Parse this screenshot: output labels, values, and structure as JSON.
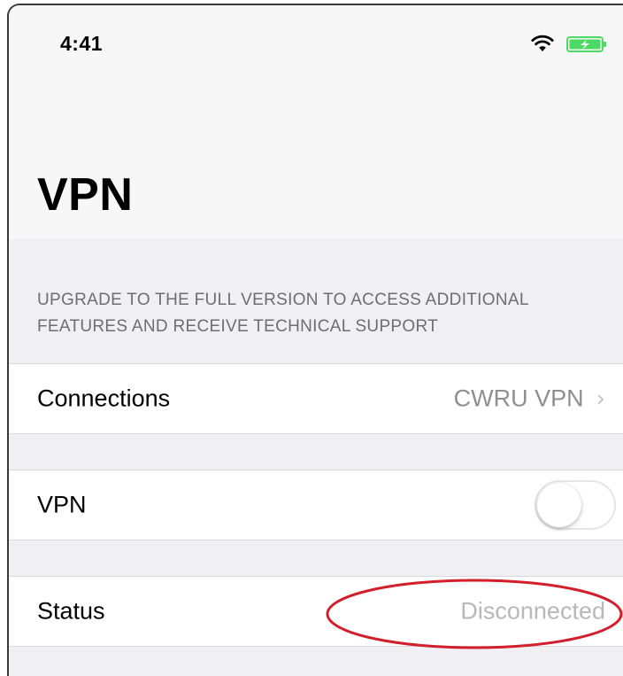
{
  "status_bar": {
    "time": "4:41",
    "wifi_icon": "wifi-icon",
    "battery_icon": "battery-charging-icon",
    "battery_color": "#4cd964"
  },
  "page": {
    "title": "VPN"
  },
  "upgrade_note": "UPGRADE TO THE FULL VERSION TO ACCESS ADDITIONAL FEATURES AND RECEIVE TECHNICAL SUPPORT",
  "connections": {
    "label": "Connections",
    "value": "CWRU VPN",
    "chevron": "›"
  },
  "vpn_toggle": {
    "label": "VPN",
    "state": "off"
  },
  "status": {
    "label": "Status",
    "value": "Disconnected"
  },
  "annotation": {
    "type": "ellipse",
    "color": "#d21f2b",
    "target": "status-value"
  }
}
